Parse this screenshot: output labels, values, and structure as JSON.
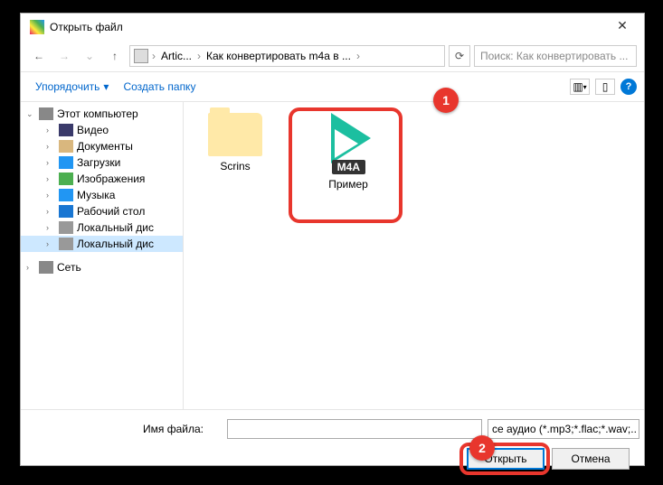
{
  "title": "Открыть файл",
  "breadcrumb": {
    "part1": "Artic...",
    "part2": "Как конвертировать m4a в ..."
  },
  "search_placeholder": "Поиск: Как конвертировать ...",
  "toolbar": {
    "organize": "Упорядочить",
    "new_folder": "Создать папку"
  },
  "tree": {
    "root": "Этот компьютер",
    "items": [
      "Видео",
      "Документы",
      "Загрузки",
      "Изображения",
      "Музыка",
      "Рабочий стол",
      "Локальный дис",
      "Локальный дис"
    ],
    "network": "Сеть"
  },
  "files": {
    "folder": "Scrins",
    "m4a": "Пример",
    "badge": "M4A"
  },
  "footer": {
    "label": "Имя файла:",
    "filter": "се аудио (*.mp3;*.flac;*.wav;..",
    "open": "Открыть",
    "cancel": "Отмена"
  },
  "markers": {
    "one": "1",
    "two": "2"
  }
}
